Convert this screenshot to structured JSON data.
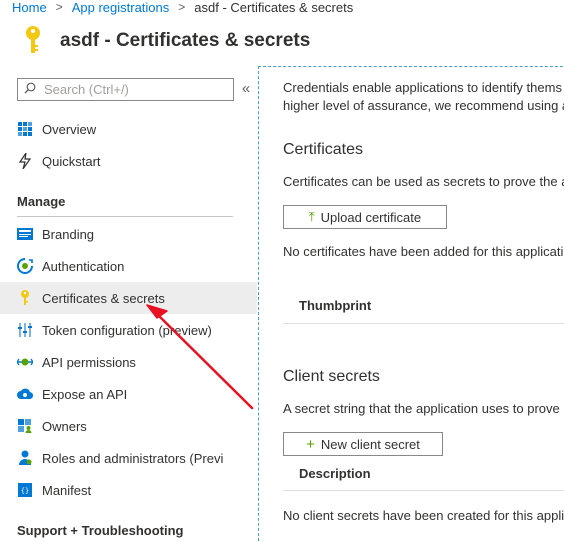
{
  "breadcrumb": {
    "home": "Home",
    "app_registrations": "App registrations",
    "current": "asdf - Certificates & secrets"
  },
  "page": {
    "title": "asdf - Certificates & secrets",
    "icon": "key-icon"
  },
  "sidebar": {
    "search_placeholder": "Search (Ctrl+/)",
    "collapse_glyph": "«",
    "top_items": [
      {
        "label": "Overview",
        "icon": "overview-icon"
      },
      {
        "label": "Quickstart",
        "icon": "quickstart-icon"
      }
    ],
    "manage_heading": "Manage",
    "manage_items": [
      {
        "label": "Branding",
        "icon": "branding-icon"
      },
      {
        "label": "Authentication",
        "icon": "authentication-icon"
      },
      {
        "label": "Certificates & secrets",
        "icon": "key-icon",
        "selected": true
      },
      {
        "label": "Token configuration (preview)",
        "icon": "token-config-icon"
      },
      {
        "label": "API permissions",
        "icon": "api-permissions-icon"
      },
      {
        "label": "Expose an API",
        "icon": "expose-api-icon"
      },
      {
        "label": "Owners",
        "icon": "owners-icon"
      },
      {
        "label": "Roles and administrators (Previ",
        "icon": "roles-icon"
      },
      {
        "label": "Manifest",
        "icon": "manifest-icon"
      }
    ],
    "support_heading": "Support + Troubleshooting"
  },
  "main": {
    "intro_line1": "Credentials enable applications to identify thems",
    "intro_line2": "higher level of assurance, we recommend using a",
    "certificates": {
      "heading": "Certificates",
      "description": "Certificates can be used as secrets to prove the ap",
      "upload_button": "Upload certificate",
      "empty_text": "No certificates have been added for this applicati",
      "column_thumbprint": "Thumbprint"
    },
    "client_secrets": {
      "heading": "Client secrets",
      "description": "A secret string that the application uses to prove",
      "new_button": "New client secret",
      "column_description": "Description",
      "empty_text": "No client secrets have been created for this applic"
    }
  },
  "colors": {
    "accent": "#0078d4",
    "selected_bg": "#ededed",
    "annotation_arrow": "#e81123",
    "key_yellow": "#f2c811",
    "add_green": "#57a300"
  }
}
